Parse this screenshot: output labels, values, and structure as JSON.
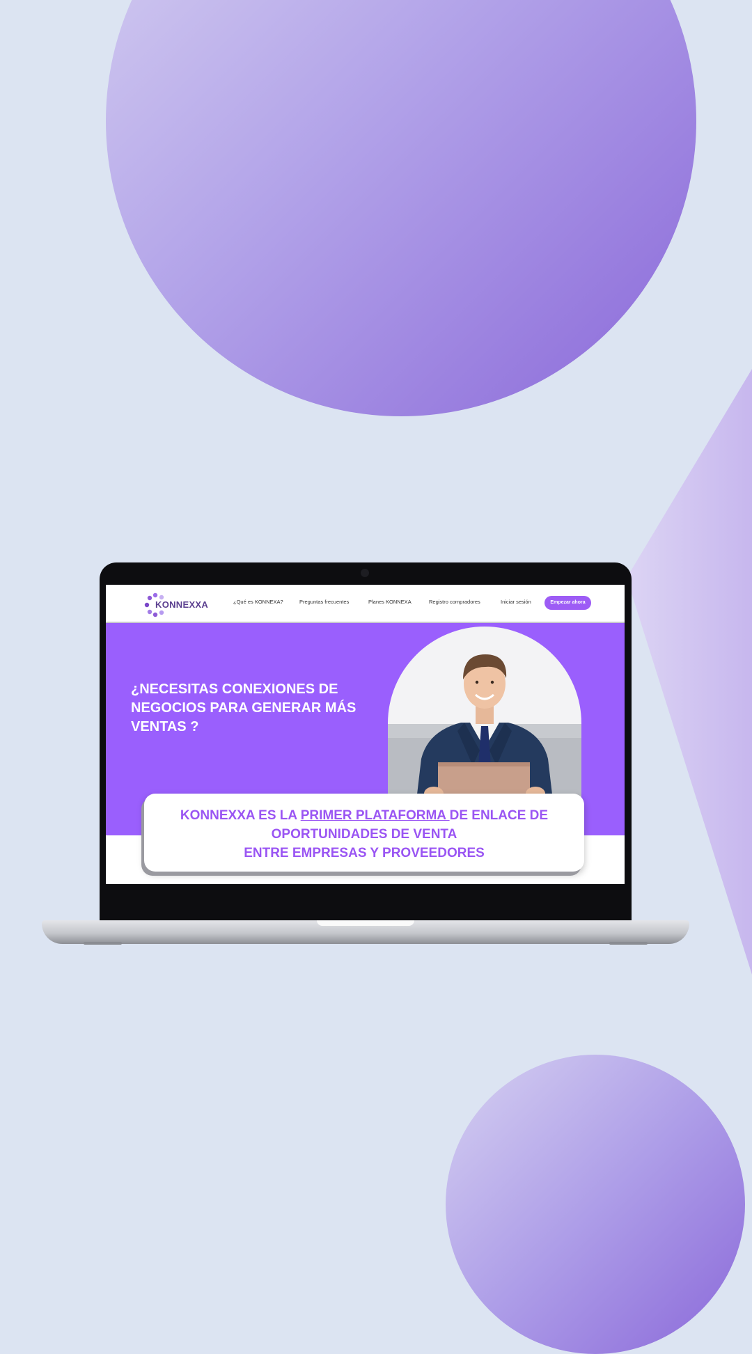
{
  "colors": {
    "background": "#dce4f2",
    "brand_purple": "#9a5ffd",
    "cta_purple": "#9d5cf5",
    "tagline_purple": "#9a55f3",
    "laptop_bezel": "#0d0d10"
  },
  "site": {
    "logo_text": "KONNEXXA",
    "nav": {
      "links": [
        "¿Qué es KONNEXA?",
        "Preguntas frecuentes",
        "Planes KONNEXA",
        "Registro compradores",
        "Iniciar sesión"
      ],
      "cta_label": "Empezar ahora"
    },
    "hero": {
      "heading": "¿NECESITAS CONEXIONES DE NEGOCIOS PARA GENERAR MÁS VENTAS ?",
      "photo": "smiling-businessman-with-laptop"
    },
    "tagline": {
      "line1_before": "KONNEXXA ES LA ",
      "line1_underlined": "PRIMER PLATAFORMA ",
      "line1_after": "DE ENLACE DE",
      "line2": "OPORTUNIDADES DE VENTA",
      "line3": "ENTRE EMPRESAS Y PROVEEDORES"
    }
  }
}
